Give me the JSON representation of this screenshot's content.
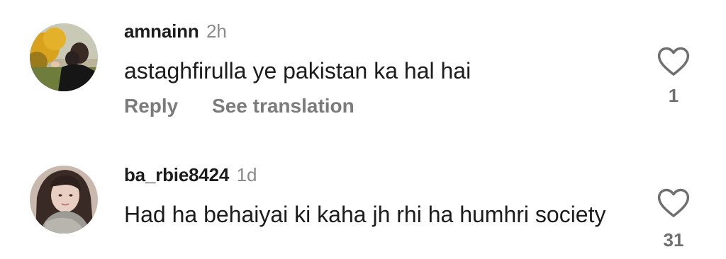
{
  "comments": [
    {
      "username": "amnainn",
      "time": "2h",
      "text": "astaghfirulla ye pakistan ka hal hai",
      "actions": {
        "reply": "Reply",
        "see_translation": "See translation"
      },
      "likes": "1",
      "like_icon": "heart-outline-icon"
    },
    {
      "username": "ba_rbie8424",
      "time": "1d",
      "text": "Had ha behaiyai ki kaha jh rhi ha humhri society",
      "likes": "31",
      "like_icon": "heart-outline-icon"
    }
  ],
  "colors": {
    "text": "#1c1c1c",
    "secondary": "#8a8a8a",
    "action": "#7b7b7b",
    "background": "#ffffff"
  }
}
